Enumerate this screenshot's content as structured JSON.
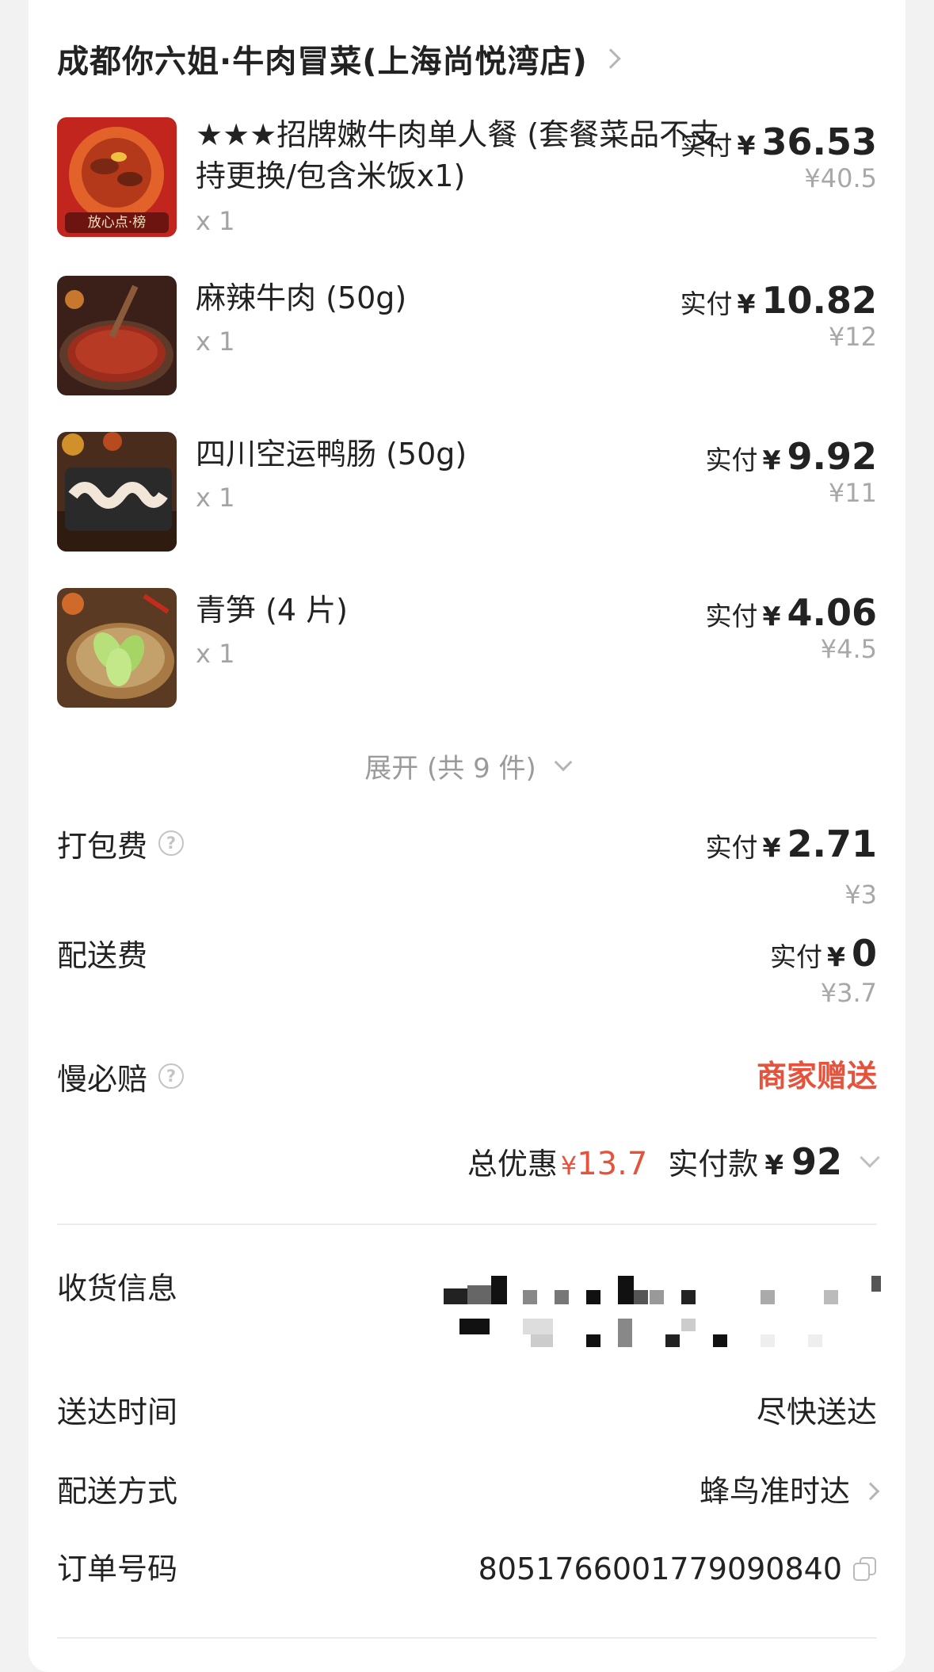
{
  "store": {
    "name": "成都你六姐·牛肉冒菜(上海尚悦湾店)"
  },
  "items": [
    {
      "name": "★★★招牌嫩牛肉单人餐 (套餐菜品不支持更换/包含米饭x1)",
      "qty": "x 1",
      "paid_label": "实付",
      "yen": "¥",
      "paid": "36.53",
      "original": "¥40.5",
      "badge": "放心点·榜"
    },
    {
      "name": "麻辣牛肉 (50g)",
      "qty": "x 1",
      "paid_label": "实付",
      "yen": "¥",
      "paid": "10.82",
      "original": "¥12"
    },
    {
      "name": "四川空运鸭肠 (50g)",
      "qty": "x 1",
      "paid_label": "实付",
      "yen": "¥",
      "paid": "9.92",
      "original": "¥11"
    },
    {
      "name": "青笋 (4 片)",
      "qty": "x 1",
      "paid_label": "实付",
      "yen": "¥",
      "paid": "4.06",
      "original": "¥4.5"
    }
  ],
  "expand": {
    "label": "展开 (共 9 件)"
  },
  "fees": {
    "packing": {
      "label": "打包费",
      "help": "?",
      "paid_label": "实付",
      "yen": "¥",
      "paid": "2.71",
      "original": "¥3"
    },
    "delivery": {
      "label": "配送费",
      "paid_label": "实付",
      "yen": "¥",
      "paid": "0",
      "original": "¥3.7"
    },
    "late_guarantee": {
      "label": "慢必赔",
      "help": "?",
      "value": "商家赠送"
    }
  },
  "summary": {
    "discount_label": "总优惠",
    "yen": "¥",
    "discount": "13.7",
    "total_label": "实付款",
    "total": "92"
  },
  "info": {
    "address_label": "收货信息",
    "time_label": "送达时间",
    "time_value": "尽快送达",
    "method_label": "配送方式",
    "method_value": "蜂鸟准时达",
    "order_label": "订单号码",
    "order_value": "8051766001779090840"
  },
  "colors": {
    "accent_red": "#e5533d",
    "muted_gray": "#a8a8a8",
    "card_bg": "#ffffff"
  },
  "icons": [
    "chevron-right-icon",
    "chevron-down-icon",
    "help-icon",
    "copy-icon"
  ]
}
